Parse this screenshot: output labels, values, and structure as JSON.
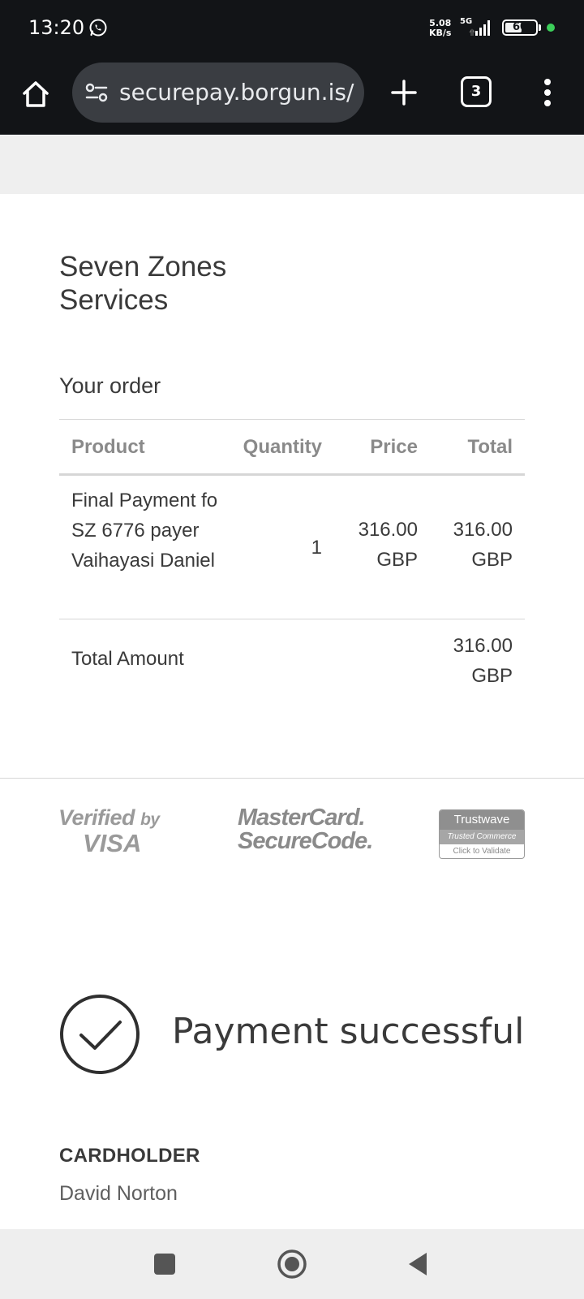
{
  "status_bar": {
    "time": "13:20",
    "net_speed_value": "5.08",
    "net_speed_unit": "KB/s",
    "network_type": "5G",
    "battery_level": "60",
    "battery_fraction": 0.6,
    "notification_icon": "whatsapp-icon",
    "dot_color": "#3ccf5a"
  },
  "browser": {
    "url": "securepay.borgun.is/s",
    "tab_count": "3",
    "icons": [
      "home-icon",
      "tune-icon",
      "plus-icon",
      "tabs-icon",
      "more-vert-icon"
    ]
  },
  "merchant": {
    "name": "Seven Zones Services"
  },
  "order": {
    "heading": "Your order",
    "columns": {
      "product": "Product",
      "quantity": "Quantity",
      "price": "Price",
      "total": "Total"
    },
    "items": [
      {
        "product": "Final Payment fo SZ 6776 payer Vaihayasi Daniel",
        "quantity": "1",
        "price": "316.00 GBP",
        "total": "316.00 GBP"
      }
    ],
    "total_label": "Total Amount",
    "total_value": "316.00 GBP"
  },
  "logos": {
    "visa_line1": "Verified",
    "visa_by": "by",
    "visa_line2": "VISA",
    "mastercard_line1": "MasterCard.",
    "mastercard_line2": "SecureCode.",
    "trustwave_top": "Trustwave",
    "trustwave_mid": "Trusted Commerce",
    "trustwave_bottom": "Click to Validate"
  },
  "result": {
    "message": "Payment successful",
    "icon": "check-circle-icon"
  },
  "cardholder": {
    "label": "CARDHOLDER",
    "name": "David Norton"
  },
  "nav": {
    "icons": [
      "recents-icon",
      "home-circle-icon",
      "back-icon"
    ]
  }
}
